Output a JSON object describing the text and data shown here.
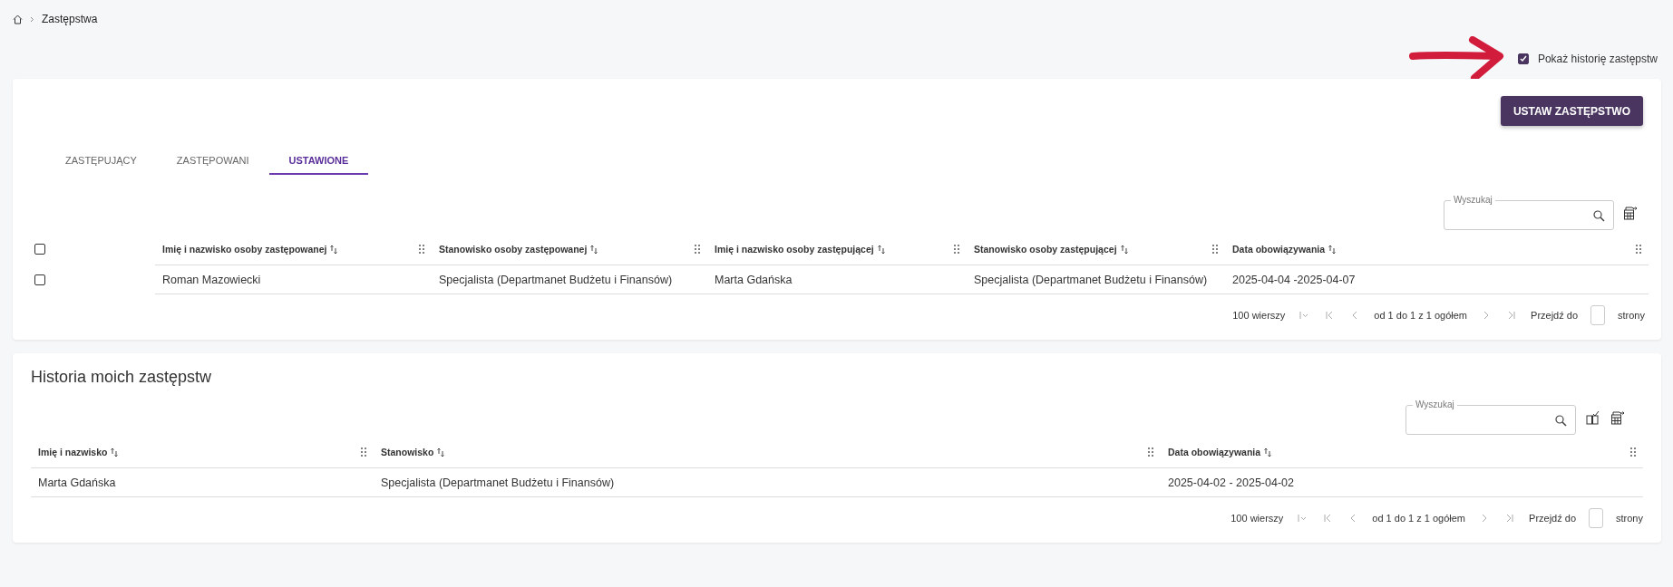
{
  "breadcrumb": {
    "items": [
      "Zastępstwa"
    ]
  },
  "history_toggle": {
    "label": "Pokaż historię zastępstw",
    "checked": true
  },
  "main_card": {
    "action_button": "USTAW ZASTĘPSTWO",
    "tabs": [
      {
        "label": "ZASTĘPUJĄCY",
        "selected": false
      },
      {
        "label": "ZASTĘPOWANI",
        "selected": false
      },
      {
        "label": "USTAWIONE",
        "selected": true
      }
    ],
    "search": {
      "label": "Wyszukaj"
    },
    "table": {
      "select_all_checked": false,
      "columns": [
        "Imię i nazwisko osoby zastępowanej",
        "Stanowisko osoby zastępowanej",
        "Imię i nazwisko osoby zastępującej",
        "Stanowisko osoby zastępującej",
        "Data obowiązywania"
      ],
      "rows": [
        {
          "checked": false,
          "cells": [
            "Roman Mazowiecki",
            "Specjalista (Departmanet Budżetu i Finansów)",
            "Marta Gdańska",
            "Specjalista (Departmanet Budżetu i Finansów)",
            "2025-04-04 -2025-04-07"
          ]
        }
      ]
    },
    "pagination": {
      "rows_per_page": "100 wierszy",
      "range": "od 1 do 1 z 1 ogółem",
      "goto_label": "Przejdź do",
      "goto_suffix": "strony"
    }
  },
  "history_card": {
    "title": "Historia moich zastępstw",
    "search": {
      "label": "Wyszukaj"
    },
    "table": {
      "columns": [
        "Imię i nazwisko",
        "Stanowisko",
        "Data obowiązywania"
      ],
      "rows": [
        {
          "cells": [
            "Marta Gdańska",
            "Specjalista (Departmanet Budżetu i Finansów)",
            "2025-04-02 - 2025-04-02"
          ]
        }
      ]
    },
    "pagination": {
      "rows_per_page": "100 wierszy",
      "range": "od 1 do 1 z 1 ogółem",
      "goto_label": "Przejdź do",
      "goto_suffix": "strony"
    }
  }
}
